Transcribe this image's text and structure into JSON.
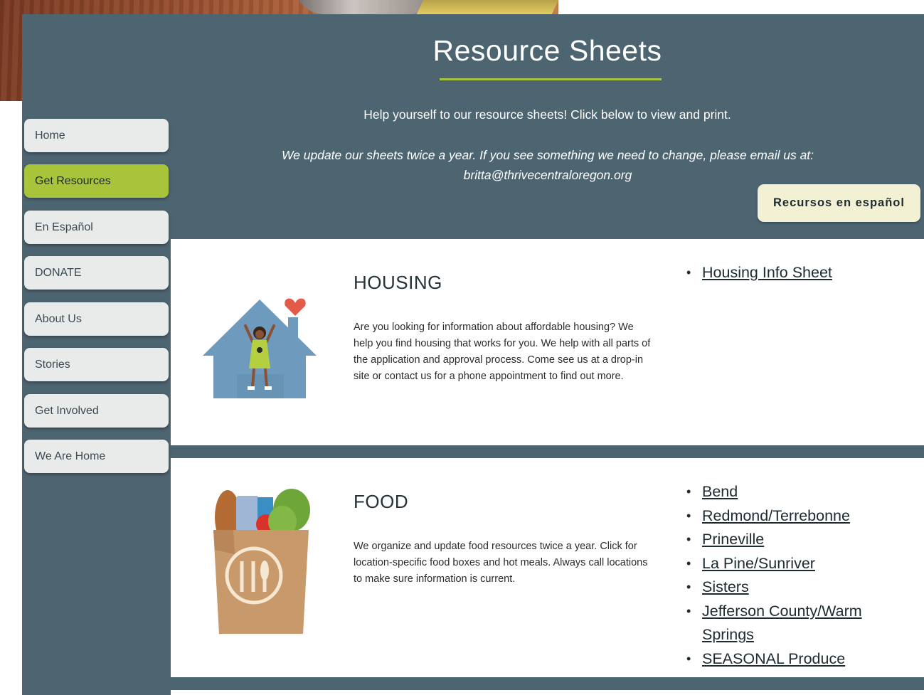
{
  "page": {
    "title": "Resource Sheets",
    "intro": "Help yourself to our resource sheets! Click below to view and print.",
    "update_note": "We update our sheets twice a year. If you see something we need to change, please email us at: britta@thrivecentraloregon.org",
    "spanish_button": "Recursos en español"
  },
  "nav": {
    "items": [
      {
        "label": "Home"
      },
      {
        "label": "Get Resources",
        "active": true
      },
      {
        "label": "En Español"
      },
      {
        "label": "DONATE"
      },
      {
        "label": "About Us"
      },
      {
        "label": "Stories"
      },
      {
        "label": "Get Involved"
      },
      {
        "label": "We Are Home"
      }
    ]
  },
  "sections": {
    "housing": {
      "heading": "HOUSING",
      "description": "Are you looking for information about affordable housing? We help you find housing that works for you. We help with all parts of the application and approval process. Come see us at a drop-in site or contact us for a phone appointment to find out more.",
      "links": [
        "Housing Info Sheet"
      ],
      "icon": "house-with-person-icon"
    },
    "food": {
      "heading": "FOOD",
      "description": "We organize and update food resources twice a year. Click for location-specific food boxes and hot meals. Always call locations to make sure information is current.",
      "links": [
        "Bend",
        "Redmond/Terrebonne",
        "Prineville",
        "La Pine/Sunriver",
        "Sisters",
        "Jefferson County/Warm Springs",
        "SEASONAL Produce "
      ],
      "icon": "grocery-bag-icon"
    }
  },
  "colors": {
    "frame": "#4d6571",
    "accent": "#a8c43a",
    "nav_button": "#e8ebe9",
    "spanish_button": "#f2f1d4"
  }
}
